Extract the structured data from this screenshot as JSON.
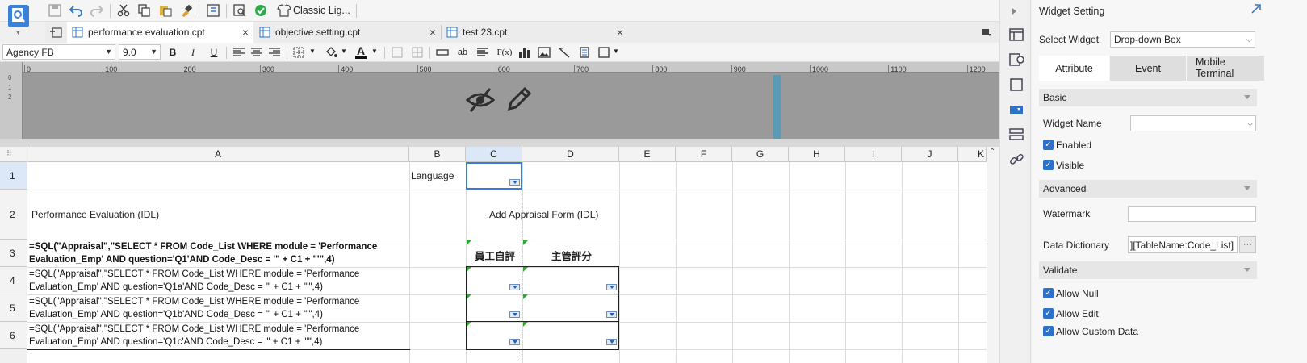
{
  "toolbar": {
    "classic_label": "Classic Lig..."
  },
  "tabs": [
    {
      "label": "performance evaluation.cpt",
      "close": "×"
    },
    {
      "label": "objective setting.cpt",
      "close": "×"
    },
    {
      "label": "test 23.cpt",
      "close": "×"
    }
  ],
  "format": {
    "font_family": "Agency FB",
    "font_size": "9.0",
    "bold": "B",
    "italic": "I",
    "underline": "U",
    "text_color": "A",
    "ab": "ab",
    "fx": "F(x)"
  },
  "ruler": [
    "0",
    "100",
    "200",
    "300",
    "400",
    "500",
    "600",
    "700",
    "800",
    "900",
    "1000",
    "1100",
    "1200"
  ],
  "columns": [
    "A",
    "B",
    "C",
    "D",
    "E",
    "F",
    "G",
    "H",
    "I",
    "J",
    "K"
  ],
  "rows": [
    "1",
    "2",
    "3",
    "4",
    "5",
    "6"
  ],
  "cells": {
    "b1": "Language",
    "a2": "Performance Evaluation (IDL)",
    "c2": "Add Appraisal Form (IDL)",
    "a3": "=SQL(\"Appraisal\",\"SELECT * FROM Code_List WHERE module = 'Performance\nEvaluation_Emp' AND question='Q1'AND Code_Desc = '\" + C1 + \"'\",4)",
    "c3": "員工自評",
    "d3": "主管評分",
    "a4": "=SQL(\"Appraisal\",\"SELECT * FROM Code_List WHERE module = 'Performance\nEvaluation_Emp' AND question='Q1a'AND Code_Desc = '\" + C1 + \"'\",4)",
    "a5": "=SQL(\"Appraisal\",\"SELECT * FROM Code_List WHERE module = 'Performance\nEvaluation_Emp' AND question='Q1b'AND Code_Desc = '\" + C1 + \"'\",4)",
    "a6": "=SQL(\"Appraisal\",\"SELECT * FROM Code_List WHERE module = 'Performance\nEvaluation_Emp' AND question='Q1c'AND Code_Desc = '\" + C1 + \"'\",4)"
  },
  "widget_panel": {
    "title": "Widget Setting",
    "select_widget_label": "Select Widget",
    "select_widget_value": "Drop-down Box",
    "tabs": [
      "Attribute",
      "Event",
      "Mobile\nTerminal"
    ],
    "basic": "Basic",
    "widget_name_label": "Widget Name",
    "widget_name_value": "",
    "enabled": "Enabled",
    "visible": "Visible",
    "advanced": "Advanced",
    "watermark_label": "Watermark",
    "watermark_value": "",
    "data_dictionary_label": "Data Dictionary",
    "data_dictionary_value": "][TableName:Code_List]",
    "more": "···",
    "validate": "Validate",
    "allow_null": "Allow Null",
    "allow_edit": "Allow Edit",
    "allow_custom_data": "Allow Custom Data"
  },
  "colors": {
    "accent": "#2d72c8",
    "selection": "#3a7bd5"
  }
}
